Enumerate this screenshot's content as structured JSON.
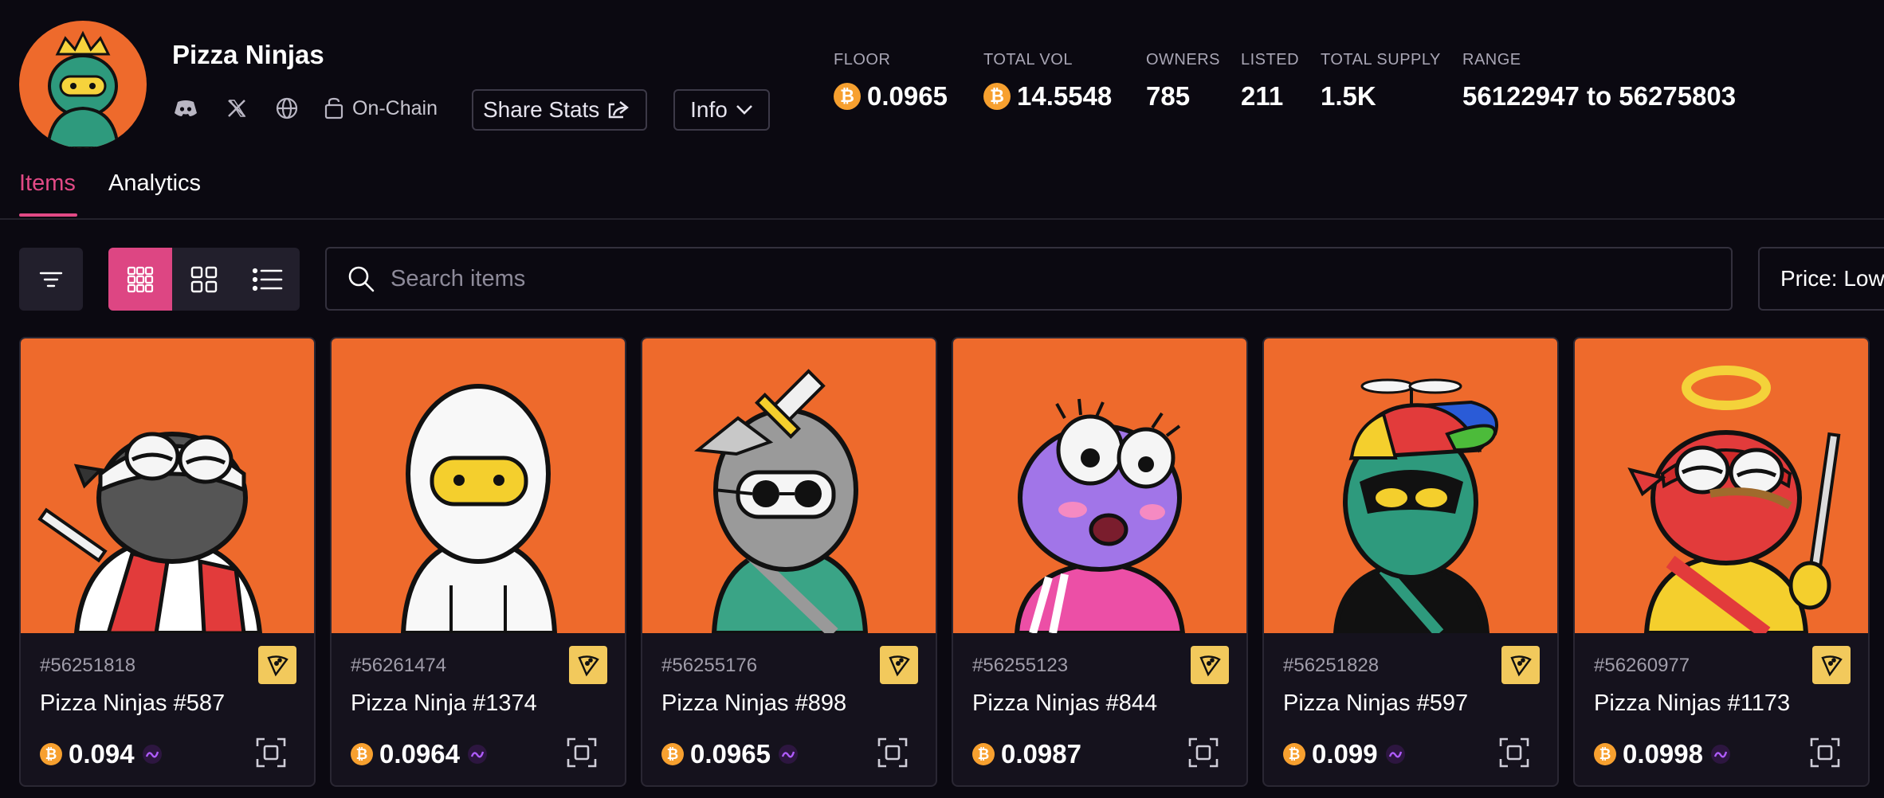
{
  "collection": {
    "title": "Pizza Ninjas",
    "onchain_label": "On-Chain",
    "share_label": "Share Stats",
    "info_label": "Info",
    "icons": [
      "discord-icon",
      "x-icon",
      "globe-icon",
      "onchain-icon",
      "share-icon",
      "chevron-down-icon"
    ]
  },
  "stats": {
    "floor": {
      "label": "FLOOR",
      "value": "0.0965"
    },
    "total_vol": {
      "label": "TOTAL VOL",
      "value": "14.5548"
    },
    "owners": {
      "label": "OWNERS",
      "value": "785"
    },
    "listed": {
      "label": "LISTED",
      "value": "211"
    },
    "total_supply": {
      "label": "TOTAL SUPPLY",
      "value": "1.5K"
    },
    "range": {
      "label": "RANGE",
      "value": "56122947 to 56275803"
    }
  },
  "tabs": {
    "items": "Items",
    "analytics": "Analytics"
  },
  "toolbar": {
    "search_placeholder": "Search items",
    "sort_label": "Price: Low"
  },
  "coin_symbol": "₿",
  "colors": {
    "accent": "#dd4683",
    "card_art_bg": "#ee6a2c",
    "bitcoin": "#f7a02f",
    "badge": "#f2c95c"
  },
  "items": [
    {
      "inscription": "#56251818",
      "name": "Pizza Ninjas #587",
      "price": "0.094",
      "magic_eden": true
    },
    {
      "inscription": "#56261474",
      "name": "Pizza Ninja #1374",
      "price": "0.0964",
      "magic_eden": true
    },
    {
      "inscription": "#56255176",
      "name": "Pizza Ninjas #898",
      "price": "0.0965",
      "magic_eden": true
    },
    {
      "inscription": "#56255123",
      "name": "Pizza Ninjas #844",
      "price": "0.0987",
      "magic_eden": false
    },
    {
      "inscription": "#56251828",
      "name": "Pizza Ninjas #597",
      "price": "0.099",
      "magic_eden": true
    },
    {
      "inscription": "#56260977",
      "name": "Pizza Ninjas #1173",
      "price": "0.0998",
      "magic_eden": true
    }
  ]
}
